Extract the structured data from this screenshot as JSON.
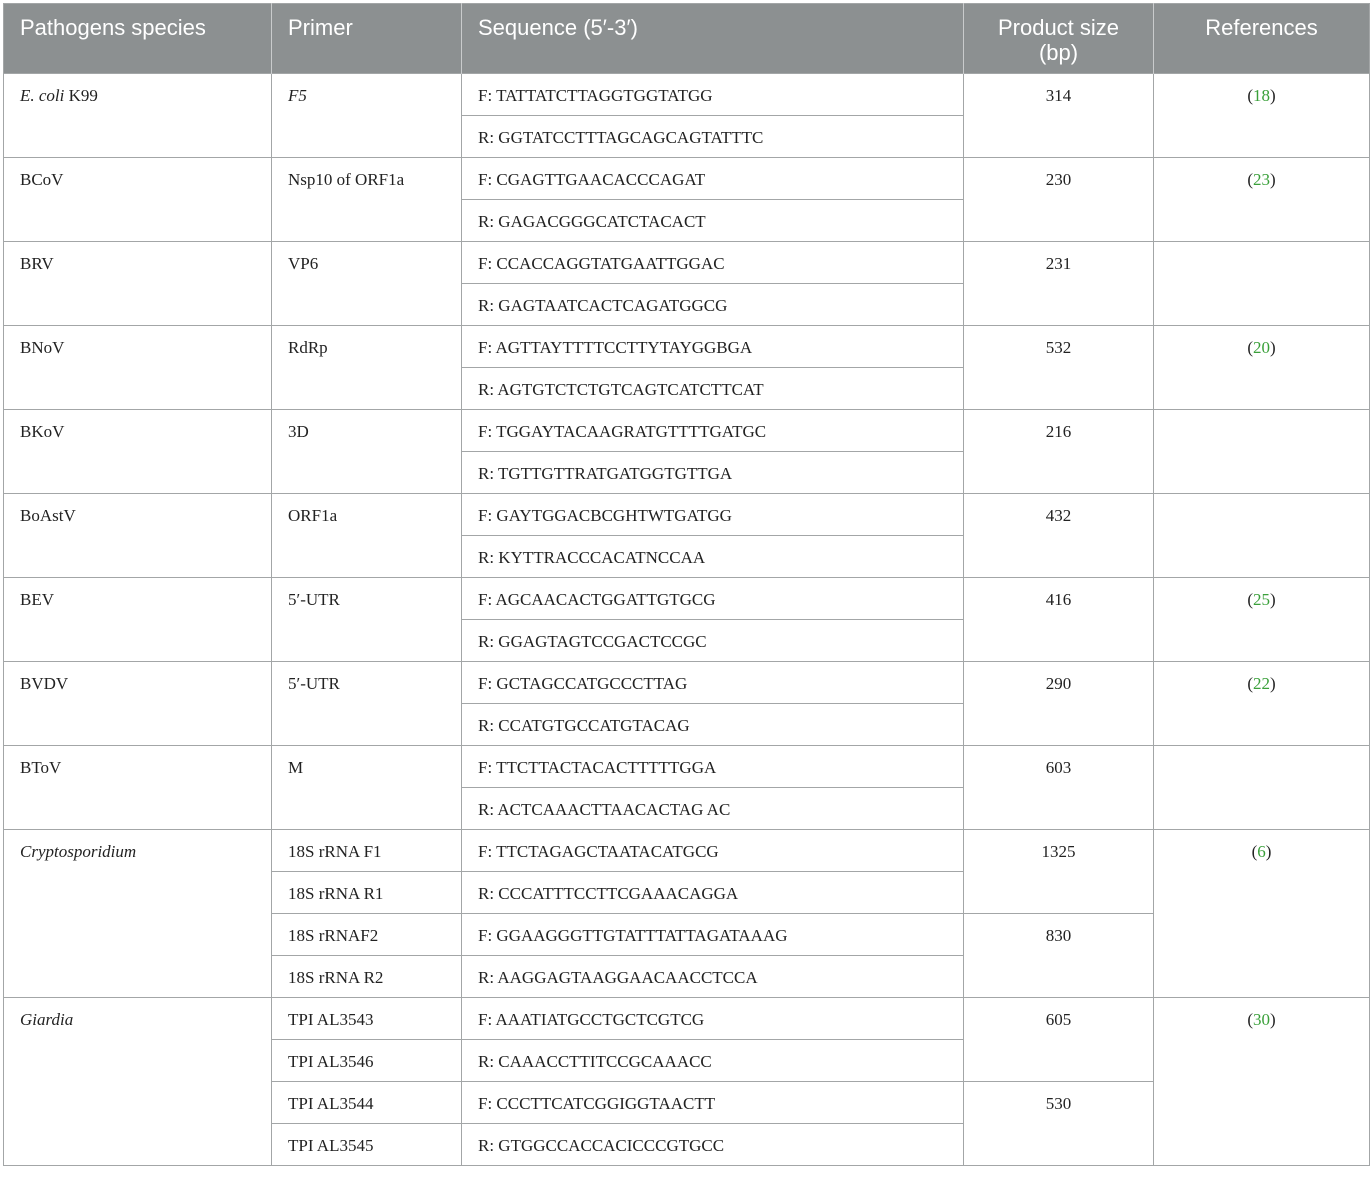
{
  "header": {
    "species": "Pathogens species",
    "primer": "Primer",
    "sequence": "Sequence (5′-3′)",
    "product_size": "Product size (bp)",
    "references": "References"
  },
  "rows": [
    {
      "species": "E. coli",
      "species_suffix": " K99",
      "italic": true,
      "primers": [
        "F5"
      ],
      "primer_italic": true,
      "sequences": [
        "F: TATTATCTTAGGTGGTATGG",
        "R: GGTATCCTTTAGCAGCAGTATTTC"
      ],
      "sizes": [
        "314"
      ],
      "ref": "18"
    },
    {
      "species": "BCoV",
      "primers": [
        "Nsp10 of ORF1a"
      ],
      "sequences": [
        "F: CGAGTTGAACACCCAGAT",
        "R: GAGACGGGCATCTACACT"
      ],
      "sizes": [
        "230"
      ],
      "ref": "23"
    },
    {
      "species": "BRV",
      "primers": [
        "VP6"
      ],
      "sequences": [
        "F: CCACCAGGTATGAATTGGAC",
        "R: GAGTAATCACTCAGATGGCG"
      ],
      "sizes": [
        "231"
      ],
      "ref": ""
    },
    {
      "species": "BNoV",
      "primers": [
        "RdRp"
      ],
      "sequences": [
        "F: AGTTAYTTTTCCTTYTAYGGBGA",
        "R: AGTGTCTCTGTCAGTCATCTTCAT"
      ],
      "sizes": [
        "532"
      ],
      "ref": "20"
    },
    {
      "species": "BKoV",
      "primers": [
        "3D"
      ],
      "sequences": [
        "F: TGGAYTACAAGRATGTTTTGATGC",
        "R: TGTTGTTRATGATGGTGTTGA"
      ],
      "sizes": [
        "216"
      ],
      "ref": ""
    },
    {
      "species": "BoAstV",
      "primers": [
        "ORF1a"
      ],
      "sequences": [
        "F: GAYTGGACBCGHTWTGATGG",
        "R: KYTTRACCCACATNCCAA"
      ],
      "sizes": [
        "432"
      ],
      "ref": ""
    },
    {
      "species": "BEV",
      "primers": [
        "5′-UTR"
      ],
      "sequences": [
        "F: AGCAACACTGGATTGTGCG",
        "R: GGAGTAGTCCGACTCCGC"
      ],
      "sizes": [
        "416"
      ],
      "ref": "25"
    },
    {
      "species": "BVDV",
      "primers": [
        "5′-UTR"
      ],
      "sequences": [
        "F: GCTAGCCATGCCCTTAG",
        "R: CCATGTGCCATGTACAG"
      ],
      "sizes": [
        "290"
      ],
      "ref": "22"
    },
    {
      "species": "BToV",
      "primers": [
        "M"
      ],
      "sequences": [
        "F: TTCTTACTACACTTTTTGGA",
        "R: ACTCAAACTTAACACTAG AC"
      ],
      "sizes": [
        "603"
      ],
      "ref": ""
    },
    {
      "species": "Cryptosporidium",
      "italic": true,
      "primers": [
        "18S rRNA F1",
        "18S rRNA R1",
        "18S rRNAF2",
        "18S rRNA R2"
      ],
      "sequences": [
        "F: TTCTAGAGCTAATACATGCG",
        "R: CCCATTTCCTTCGAAACAGGA",
        "F: GGAAGGGTTGTATTTATTAGATAAAG",
        "R: AAGGAGTAAGGAACAACCTCCA"
      ],
      "sizes": [
        "1325",
        "830"
      ],
      "ref": "6"
    },
    {
      "species": "Giardia",
      "italic": true,
      "primers": [
        "TPI AL3543",
        "TPI AL3546",
        "TPI AL3544",
        "TPI AL3545"
      ],
      "sequences": [
        "F: AAATIATGCCTGCTCGTCG",
        "R: CAAACCTTITCCGCAAACC",
        "F: CCCTTCATCGGIGGTAACTT",
        "R: GTGGCCACCACICCCGTGCC"
      ],
      "sizes": [
        "605",
        "530"
      ],
      "ref": "30"
    }
  ]
}
